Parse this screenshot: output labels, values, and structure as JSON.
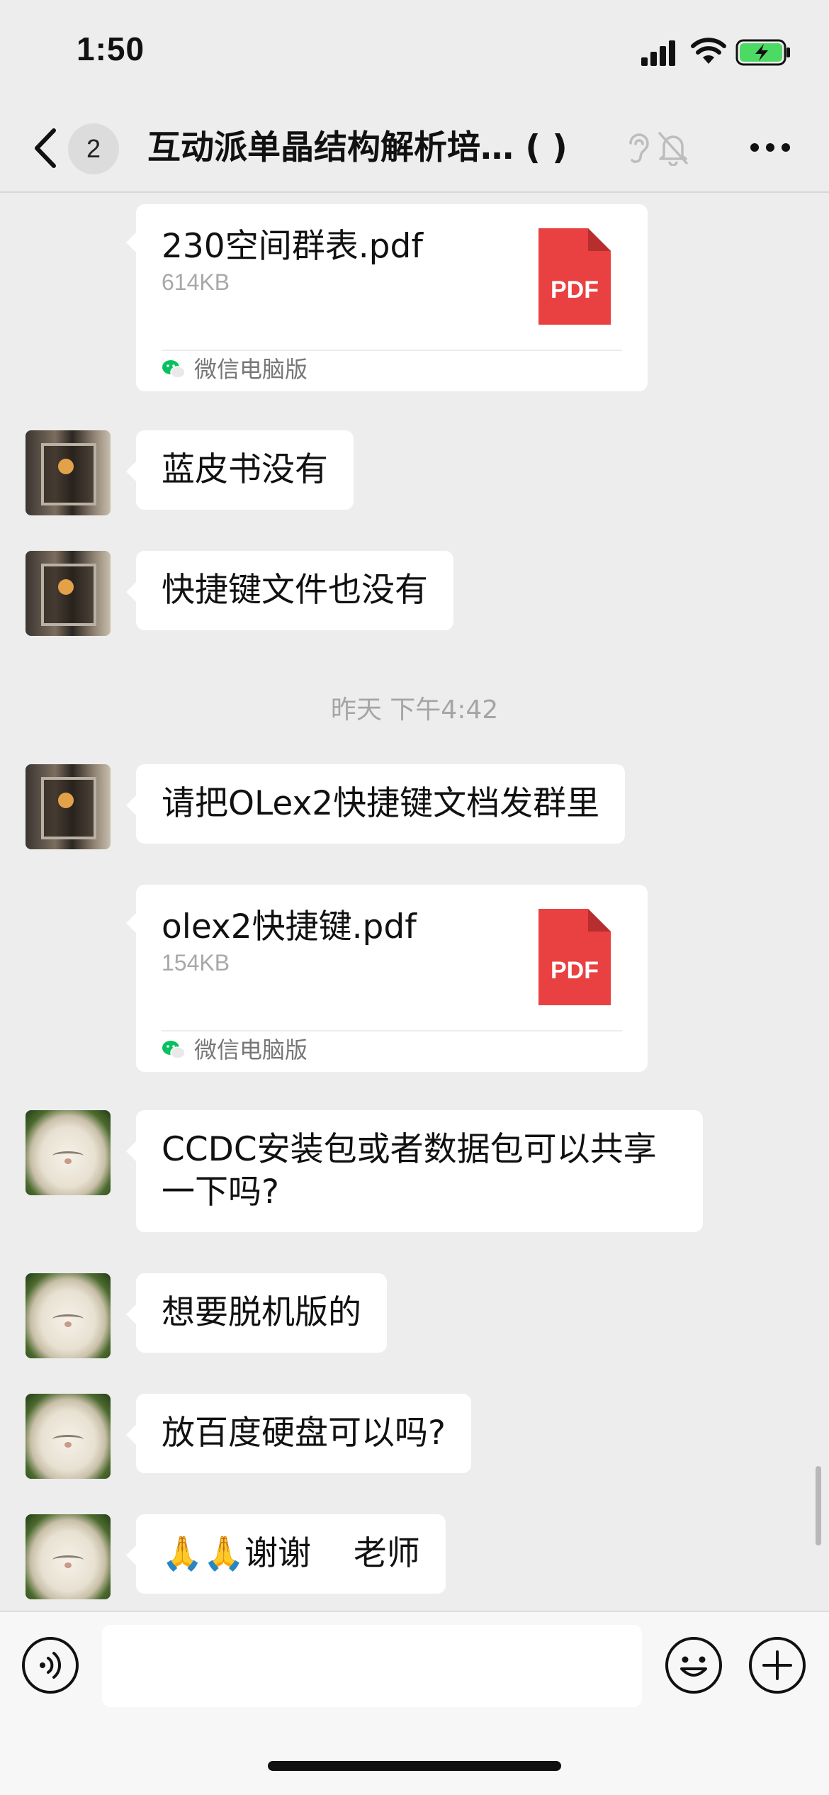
{
  "status_bar": {
    "time": "1:50"
  },
  "nav": {
    "unread_count": "2",
    "title": "互动派单晶结构解析培… (    )",
    "icons": [
      "back-icon",
      "ear-icon",
      "mute-bell-icon",
      "more-icon"
    ]
  },
  "messages": [
    {
      "type": "file",
      "file_name": "230空间群表.pdf",
      "file_size": "614KB",
      "file_icon_label": "PDF",
      "source": "微信电脑版"
    },
    {
      "type": "text",
      "text": "蓝皮书没有",
      "avatar": "room-photo-avatar"
    },
    {
      "type": "text",
      "text": "快捷键文件也没有",
      "avatar": "room-photo-avatar"
    },
    {
      "type": "timestamp",
      "text": "昨天 下午4:42"
    },
    {
      "type": "text",
      "text": "请把OLex2快捷键文档发群里",
      "avatar": "room-photo-avatar"
    },
    {
      "type": "file",
      "file_name": "olex2快捷键.pdf",
      "file_size": "154KB",
      "file_icon_label": "PDF",
      "source": "微信电脑版"
    },
    {
      "type": "text",
      "text": "CCDC安装包或者数据包可以共享\n一下吗?",
      "avatar": "cat-avatar"
    },
    {
      "type": "text",
      "text": "想要脱机版的",
      "avatar": "cat-avatar"
    },
    {
      "type": "text",
      "text": "放百度硬盘可以吗?",
      "avatar": "cat-avatar"
    },
    {
      "type": "text",
      "text": "🙏🙏谢谢    老师",
      "avatar": "cat-avatar"
    }
  ],
  "input_bar": {
    "value": "",
    "icons": [
      "voice-icon",
      "emoji-icon",
      "plus-icon"
    ]
  },
  "colors": {
    "background": "#ededed",
    "bubble": "#ffffff",
    "pdf_red": "#e94141",
    "wechat_green": "#07c160",
    "battery_green": "#4cd964"
  }
}
